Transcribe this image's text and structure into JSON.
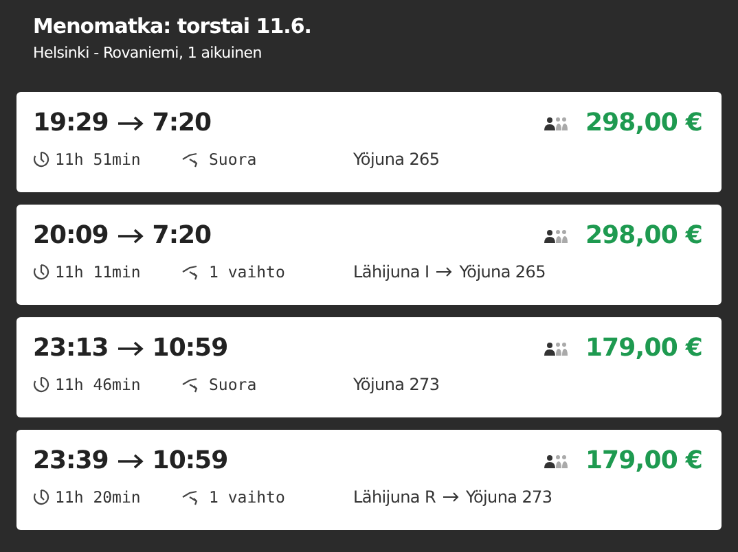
{
  "header": {
    "title": "Menomatka: torstai 11.6.",
    "subtitle": "Helsinki - Rovaniemi, 1 aikuinen"
  },
  "trips": [
    {
      "departure": "19:29",
      "arrival": "7:20",
      "duration": "11h 51min",
      "changes": "Suora",
      "trains": [
        "Yöjuna 265"
      ],
      "price": "298,00 €"
    },
    {
      "departure": "20:09",
      "arrival": "7:20",
      "duration": "11h 11min",
      "changes": "1 vaihto",
      "trains": [
        "Lähijuna I",
        "Yöjuna 265"
      ],
      "price": "298,00 €"
    },
    {
      "departure": "23:13",
      "arrival": "10:59",
      "duration": "11h 46min",
      "changes": "Suora",
      "trains": [
        "Yöjuna 273"
      ],
      "price": "179,00 €"
    },
    {
      "departure": "23:39",
      "arrival": "10:59",
      "duration": "11h 20min",
      "changes": "1 vaihto",
      "trains": [
        "Lähijuna R",
        "Yöjuna 273"
      ],
      "price": "179,00 €"
    }
  ]
}
